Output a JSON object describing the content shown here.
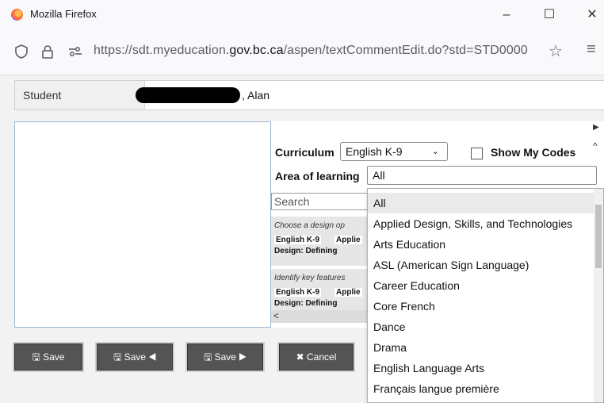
{
  "window": {
    "app_title": "Mozilla Firefox",
    "minimize": "–",
    "maximize": "☐",
    "close": "✕"
  },
  "urlbar": {
    "url_prefix": "https://sdt.myeducation.",
    "url_domain": "gov.bc.ca",
    "url_suffix": "/aspen/textCommentEdit.do?std=STD0000",
    "bookmark": "☆",
    "menu": "≡"
  },
  "student": {
    "label": "Student",
    "name": ", Alan"
  },
  "filters": {
    "curriculum_label": "Curriculum",
    "curriculum_value": "English K-9",
    "show_my_codes": "Show My Codes",
    "area_label": "Area of learning",
    "area_value": "All",
    "search_placeholder": "Search"
  },
  "cards": [
    {
      "desc": "Choose a design op",
      "tag1": "English K-9",
      "tag2": "Applie",
      "design": "Design: Defining"
    },
    {
      "desc": "Identify key features",
      "tag1": "English K-9",
      "tag2": "Applie",
      "design": "Design: Defining"
    }
  ],
  "buttons": {
    "save": "Save",
    "save_prev": "Save",
    "save_next": "Save",
    "cancel": "Cancel"
  },
  "dropdown_options": [
    "All",
    "Applied Design, Skills, and Technologies",
    "Arts Education",
    "ASL (American Sign Language)",
    "Career Education",
    "Core French",
    "Dance",
    "Drama",
    "English Language Arts",
    "Français langue première"
  ],
  "colors": {
    "button_bg": "#545454",
    "selected_option": "#eaeaea"
  }
}
